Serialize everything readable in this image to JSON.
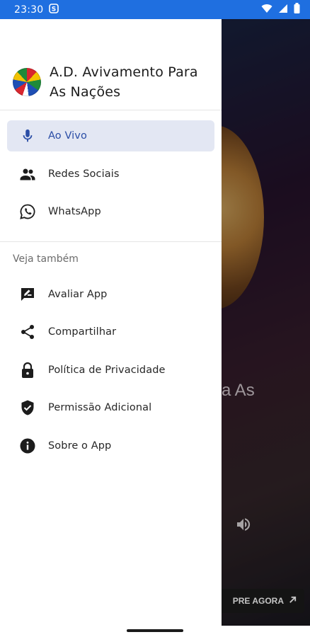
{
  "status_bar": {
    "time": "23:30",
    "notification_icon": "s-circle-icon",
    "right_icons": [
      "wifi-icon",
      "signal-icon",
      "battery-icon"
    ]
  },
  "drawer": {
    "app_title_line1": "A.D. Avivamento Para",
    "app_title_line2": "As Nações",
    "primary_items": [
      {
        "label": "Ao Vivo",
        "icon": "microphone-icon",
        "active": true
      },
      {
        "label": "Redes Sociais",
        "icon": "people-icon",
        "active": false
      },
      {
        "label": "WhatsApp",
        "icon": "whatsapp-icon",
        "active": false
      }
    ],
    "section_label": "Veja também",
    "secondary_items": [
      {
        "label": "Avaliar App",
        "icon": "rate-review-icon"
      },
      {
        "label": "Compartilhar",
        "icon": "share-icon"
      },
      {
        "label": "Política de Privacidade",
        "icon": "lock-icon"
      },
      {
        "label": "Permissão Adicional",
        "icon": "shield-check-icon"
      },
      {
        "label": "Sobre o App",
        "icon": "info-icon"
      }
    ]
  },
  "background": {
    "title_fragment": "ra As",
    "buy_label": "PRE AGORA"
  },
  "colors": {
    "status_bar": "#1f6fe0",
    "active_item_bg": "#e3e7f3",
    "active_item_text": "#2a4da6"
  }
}
